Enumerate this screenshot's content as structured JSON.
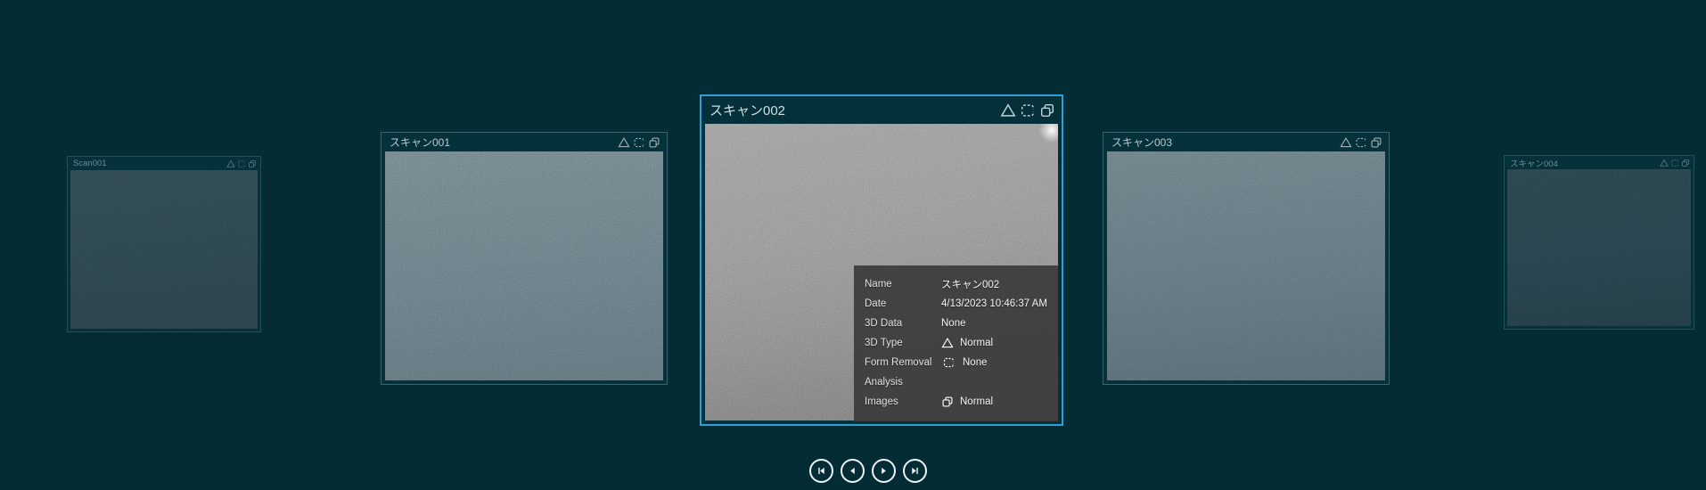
{
  "colors": {
    "background": "#032c35",
    "selected_border": "#2e9fd6",
    "card_border": "#6f95a0",
    "tooltip_background": "#3b3b3b",
    "icon_color": "#c3d2d6",
    "nav_color": "#eef5f6"
  },
  "cards": {
    "far_left": {
      "title": "Scan001",
      "icons": [
        "3d-type-triangle-icon",
        "form-removal-icon",
        "images-icon"
      ]
    },
    "left": {
      "title": "スキャン001",
      "icons": [
        "3d-type-triangle-icon",
        "form-removal-icon",
        "images-icon"
      ]
    },
    "center": {
      "title": "スキャン002",
      "selected": true,
      "icons": [
        "3d-type-triangle-icon",
        "form-removal-icon",
        "images-icon"
      ]
    },
    "right": {
      "title": "スキャン003",
      "icons": [
        "3d-type-triangle-icon",
        "form-removal-icon",
        "images-icon"
      ]
    },
    "far_right": {
      "title": "スキャン004",
      "icons": [
        "3d-type-triangle-icon",
        "form-removal-icon",
        "images-icon"
      ]
    }
  },
  "tooltip": {
    "rows": [
      {
        "label": "Name",
        "value": "スキャン002"
      },
      {
        "label": "Date",
        "value": "4/13/2023 10:46:37 AM"
      },
      {
        "label": "3D Data",
        "value": "None"
      },
      {
        "label": "3D Type",
        "value": "Normal",
        "icon": "triangle-icon"
      },
      {
        "label": "Form Removal",
        "value": "None",
        "icon": "form-removal-icon"
      },
      {
        "label": "Analysis",
        "value": ""
      },
      {
        "label": "Images",
        "value": "Normal",
        "icon": "images-icon"
      }
    ]
  },
  "navigation": {
    "buttons": [
      {
        "icon": "skip-first-icon"
      },
      {
        "icon": "previous-icon"
      },
      {
        "icon": "next-icon"
      },
      {
        "icon": "skip-last-icon"
      }
    ]
  }
}
